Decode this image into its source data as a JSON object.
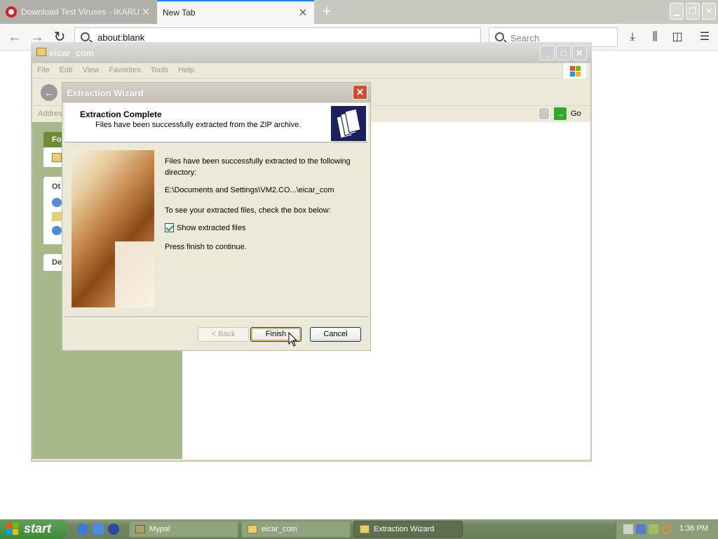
{
  "browser": {
    "tabs": [
      {
        "title": "Download Test Viruses - IKARUS S",
        "active": false
      },
      {
        "title": "New Tab",
        "active": true
      }
    ],
    "url": "about:blank",
    "search_placeholder": "Search"
  },
  "explorer": {
    "title": "eicar_com",
    "menu": [
      "File",
      "Edit",
      "View",
      "Favorites",
      "Tools",
      "Help"
    ],
    "address_label": "Address",
    "go_label": "Go",
    "left_pane": {
      "folder_tasks": "Fo",
      "other_places": "Ot",
      "details": "De"
    }
  },
  "wizard": {
    "title": "Extraction Wizard",
    "header_title": "Extraction Complete",
    "header_subtitle": "Files have been successfully extracted from the ZIP archive.",
    "body_line1": "Files have been successfully extracted to the following directory:",
    "path": "E:\\Documents and Settings\\VM2.CO...\\eicar_com",
    "instruction": "To see your extracted files, check the box below:",
    "checkbox_label": "Show extracted files",
    "checkbox_checked": true,
    "finish_note": "Press finish to continue.",
    "back_label": "< Back",
    "finish_label": "Finish",
    "cancel_label": "Cancel"
  },
  "taskbar": {
    "start_label": "start",
    "tasks": [
      {
        "label": "Mypal",
        "active": false
      },
      {
        "label": "eicar_com",
        "active": false
      },
      {
        "label": "Extraction Wizard",
        "active": true
      }
    ],
    "clock": "1:36 PM"
  },
  "colors": {
    "wizard_logo_bg": "#1a2060",
    "explorer_left_pane": "#a7b88a",
    "firefox_accent": "#0a84ff"
  }
}
